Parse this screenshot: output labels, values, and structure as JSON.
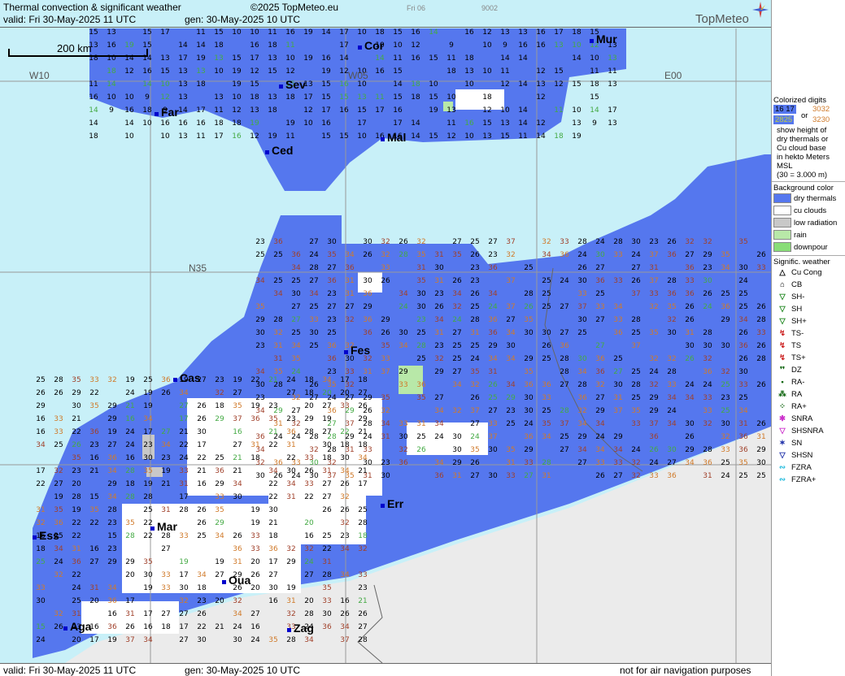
{
  "header": {
    "title": "Thermal convection & significant weather",
    "copyright": "©2025 TopMeteo.eu",
    "valid": "valid:  Fri  30-May-2025  11 UTC",
    "gen": "gen: 30-May-2025 10 UTC",
    "small_day": "Fri 06",
    "small_code": "9002",
    "logo": "TopMeteo"
  },
  "scale": {
    "label": "200 km"
  },
  "grid_labels": {
    "w10": "W10",
    "w05": "W05",
    "e00": "E00",
    "n35": "N35"
  },
  "cities": [
    {
      "name": "Mur"
    },
    {
      "name": "Cor"
    },
    {
      "name": "Sev"
    },
    {
      "name": "Far"
    },
    {
      "name": "Ced"
    },
    {
      "name": "Mal"
    },
    {
      "name": "Cas"
    },
    {
      "name": "Fes"
    },
    {
      "name": "Err"
    },
    {
      "name": "Mar"
    },
    {
      "name": "Ess"
    },
    {
      "name": "Oua"
    },
    {
      "name": "Aga"
    },
    {
      "name": "Zag"
    }
  ],
  "legend": {
    "colorized_title": "Colorized digits",
    "sample_blue": "16 17",
    "or": "or",
    "sample_orange": "3032",
    "sample_green": "2825",
    "sample_brown": "3230",
    "description": [
      "show height of",
      "dry thermals or",
      "Cu cloud base",
      "in hekto Meters",
      "MSL",
      "(30 = 3.000 m)"
    ],
    "background_title": "Background color",
    "backgrounds": [
      {
        "label": "dry thermals",
        "color": "#5577ee"
      },
      {
        "label": "cu clouds",
        "color": "#ffffff"
      },
      {
        "label": "low radiation",
        "color": "#c8c8c8"
      },
      {
        "label": "rain",
        "color": "#b8e8a8"
      },
      {
        "label": "downpour",
        "color": "#88dd77"
      }
    ],
    "weather_title": "Signific. weather",
    "weather": [
      {
        "label": "Cu Cong",
        "symbol": "△",
        "color": "#000000"
      },
      {
        "label": "CB",
        "symbol": "⌂",
        "color": "#000000"
      },
      {
        "label": "SH-",
        "symbol": "▽",
        "color": "#228822"
      },
      {
        "label": "SH",
        "symbol": "▽",
        "color": "#228822"
      },
      {
        "label": "SH+",
        "symbol": "▽",
        "color": "#228822"
      },
      {
        "label": "TS-",
        "symbol": "↯",
        "color": "#cc2222"
      },
      {
        "label": "TS",
        "symbol": "↯",
        "color": "#cc2222"
      },
      {
        "label": "TS+",
        "symbol": "↯",
        "color": "#cc2222"
      },
      {
        "label": "DZ",
        "symbol": "❜❜",
        "color": "#116611"
      },
      {
        "label": "RA-",
        "symbol": "•",
        "color": "#116611"
      },
      {
        "label": "RA",
        "symbol": "⁂",
        "color": "#116611"
      },
      {
        "label": "RA+",
        "symbol": "⁘",
        "color": "#116611"
      },
      {
        "label": "SNRA",
        "symbol": "✱",
        "color": "#cc33cc"
      },
      {
        "label": "SHSNRA",
        "symbol": "▽",
        "color": "#cc33cc"
      },
      {
        "label": "SN",
        "symbol": "✶",
        "color": "#2233aa"
      },
      {
        "label": "SHSN",
        "symbol": "▽",
        "color": "#2233aa"
      },
      {
        "label": "FZRA",
        "symbol": "∾",
        "color": "#22bbdd"
      },
      {
        "label": "FZRA+",
        "symbol": "∾",
        "color": "#22bbdd"
      }
    ]
  },
  "footer": {
    "valid": "valid:  Fri  30-May-2025  11 UTC",
    "gen": "gen: 30-May-2025 10 UTC",
    "disclaimer": "not for air navigation purposes"
  },
  "colors": {
    "sea": "#c8f0f8",
    "dry_thermals": "#5577ee",
    "cu": "#ffffff",
    "no_data": "#ebebeb",
    "digit_dark": "#000000",
    "digit_orange": "#d07a2a",
    "digit_brown": "#a0402a",
    "digit_green": "#44aa44"
  }
}
